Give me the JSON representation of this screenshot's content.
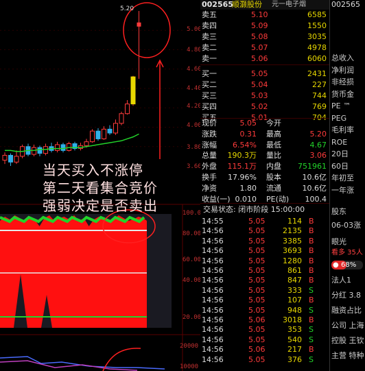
{
  "stock": {
    "code": "002565",
    "name": "顺灏股份",
    "sector": "元一电子烟"
  },
  "side_code": "002565",
  "chart": {
    "price_labels": [
      "5.20",
      "5.00",
      "4.80",
      "4.60",
      "4.40",
      "4.20",
      "4.00",
      "3.80",
      "3.60"
    ],
    "high_label": "5.20",
    "indicator_labels": [
      "100.0",
      "80.00",
      "60.00",
      "40.00",
      "20.00"
    ],
    "volume_labels": [
      "20000",
      "10000"
    ],
    "annotation": [
      "当天买入不涨停",
      "第二天看集合竞价",
      "强弱决定是否卖出"
    ],
    "candles": [
      {
        "o": 3.66,
        "c": 3.71,
        "h": 3.74,
        "l": 3.62
      },
      {
        "o": 3.71,
        "c": 3.64,
        "h": 3.73,
        "l": 3.6
      },
      {
        "o": 3.64,
        "c": 3.7,
        "h": 3.76,
        "l": 3.62
      },
      {
        "o": 3.7,
        "c": 3.8,
        "h": 3.82,
        "l": 3.68
      },
      {
        "o": 3.8,
        "c": 3.72,
        "h": 3.83,
        "l": 3.7
      },
      {
        "o": 3.72,
        "c": 3.79,
        "h": 3.82,
        "l": 3.7
      },
      {
        "o": 3.79,
        "c": 3.73,
        "h": 3.81,
        "l": 3.7
      },
      {
        "o": 3.73,
        "c": 3.8,
        "h": 3.83,
        "l": 3.71
      },
      {
        "o": 3.8,
        "c": 3.76,
        "h": 3.84,
        "l": 3.74
      },
      {
        "o": 3.76,
        "c": 3.82,
        "h": 3.85,
        "l": 3.74
      },
      {
        "o": 3.82,
        "c": 3.76,
        "h": 3.84,
        "l": 3.74
      },
      {
        "o": 3.76,
        "c": 3.83,
        "h": 3.85,
        "l": 3.75
      },
      {
        "o": 3.83,
        "c": 3.78,
        "h": 3.85,
        "l": 3.76
      },
      {
        "o": 3.78,
        "c": 3.81,
        "h": 3.84,
        "l": 3.76
      },
      {
        "o": 3.81,
        "c": 3.85,
        "h": 3.88,
        "l": 3.79
      },
      {
        "o": 3.85,
        "c": 3.96,
        "h": 3.98,
        "l": 3.84
      },
      {
        "o": 3.96,
        "c": 3.88,
        "h": 3.99,
        "l": 3.86
      },
      {
        "o": 3.88,
        "c": 3.98,
        "h": 4.01,
        "l": 3.87
      },
      {
        "o": 3.98,
        "c": 3.94,
        "h": 4.02,
        "l": 3.92
      },
      {
        "o": 3.94,
        "c": 4.04,
        "h": 4.08,
        "l": 3.92
      },
      {
        "o": 4.04,
        "c": 4.14,
        "h": 4.16,
        "l": 4.02
      },
      {
        "o": 4.14,
        "c": 4.24,
        "h": 4.28,
        "l": 4.13
      },
      {
        "o": 4.24,
        "c": 4.52,
        "h": 4.53,
        "l": 4.22
      },
      {
        "o": 4.52,
        "c": 5.05,
        "h": 5.2,
        "l": 4.5
      }
    ],
    "ma": [
      3.76,
      3.76,
      3.75,
      3.75,
      3.76,
      3.76,
      3.77,
      3.77,
      3.78,
      3.78,
      3.78,
      3.79,
      3.79,
      3.79,
      3.8,
      3.81,
      3.82,
      3.83,
      3.84,
      3.85,
      3.86,
      3.88,
      3.9,
      3.93
    ]
  },
  "order_book": [
    {
      "label": "卖五",
      "price": "5.10",
      "vol": "6585"
    },
    {
      "label": "卖四",
      "price": "5.09",
      "vol": "1550"
    },
    {
      "label": "卖三",
      "price": "5.08",
      "vol": "3035"
    },
    {
      "label": "卖二",
      "price": "5.07",
      "vol": "4978"
    },
    {
      "label": "卖一",
      "price": "5.06",
      "vol": "6060"
    },
    {
      "label": "买一",
      "price": "5.05",
      "vol": "2431"
    },
    {
      "label": "买二",
      "price": "5.04",
      "vol": "227"
    },
    {
      "label": "买三",
      "price": "5.03",
      "vol": "744"
    },
    {
      "label": "买四",
      "price": "5.02",
      "vol": "769"
    },
    {
      "label": "买五",
      "price": "5.01",
      "vol": "704"
    }
  ],
  "stats": [
    {
      "l1": "现价",
      "v1": "5.05",
      "l2": "今开",
      "v2": "",
      "c1": "red",
      "c2": "red"
    },
    {
      "l1": "涨跌",
      "v1": "0.31",
      "l2": "最高",
      "v2": "5.20",
      "c1": "red",
      "c2": "red"
    },
    {
      "l1": "涨幅",
      "v1": "6.54%",
      "l2": "最低",
      "v2": "4.67",
      "c1": "red",
      "c2": "green"
    },
    {
      "l1": "总量",
      "v1": "190.3万",
      "l2": "量比",
      "v2": "3.06",
      "c1": "yellow",
      "c2": "red"
    },
    {
      "l1": "外盘",
      "v1": "115.1万",
      "l2": "内盘",
      "v2": "751961",
      "c1": "red",
      "c2": "green"
    },
    {
      "l1": "换手",
      "v1": "17.96%",
      "l2": "股本",
      "v2": "10.6亿",
      "c1": "white",
      "c2": "white"
    },
    {
      "l1": "净资",
      "v1": "1.80",
      "l2": "流通",
      "v2": "10.6亿",
      "c1": "white",
      "c2": "white"
    },
    {
      "l1": "收益(一)",
      "v1": "0.010",
      "l2": "PE(动)",
      "v2": "100.4",
      "c1": "white",
      "c2": "white"
    }
  ],
  "trade_status": "交易状态: 闭市阶段 15:00:00",
  "ticks": [
    {
      "time": "14:55",
      "price": "5.05",
      "vol": "114",
      "bs": "B"
    },
    {
      "time": "14:56",
      "price": "5.05",
      "vol": "2135",
      "bs": "B"
    },
    {
      "time": "14:56",
      "price": "5.05",
      "vol": "3385",
      "bs": "B"
    },
    {
      "time": "14:56",
      "price": "5.05",
      "vol": "3693",
      "bs": "B"
    },
    {
      "time": "14:56",
      "price": "5.05",
      "vol": "1280",
      "bs": "B"
    },
    {
      "time": "14:56",
      "price": "5.05",
      "vol": "861",
      "bs": "B"
    },
    {
      "time": "14:56",
      "price": "5.05",
      "vol": "847",
      "bs": "B"
    },
    {
      "time": "14:56",
      "price": "5.05",
      "vol": "333",
      "bs": "S"
    },
    {
      "time": "14:56",
      "price": "5.05",
      "vol": "107",
      "bs": "B"
    },
    {
      "time": "14:56",
      "price": "5.05",
      "vol": "948",
      "bs": "S"
    },
    {
      "time": "14:56",
      "price": "5.06",
      "vol": "3018",
      "bs": "B"
    },
    {
      "time": "14:56",
      "price": "5.05",
      "vol": "353",
      "bs": "S"
    },
    {
      "time": "14:56",
      "price": "5.05",
      "vol": "540",
      "bs": "S"
    },
    {
      "time": "14:56",
      "price": "5.06",
      "vol": "217",
      "bs": "B"
    },
    {
      "time": "14:56",
      "price": "5.05",
      "vol": "376",
      "bs": "S"
    }
  ],
  "side": {
    "items": [
      "总收入",
      "净利润",
      "非经损",
      "货币金",
      "PE ™",
      "PEG",
      "毛利率",
      "ROE",
      "20日",
      "60日",
      "年初至",
      "一年涨"
    ],
    "items2": [
      "股东",
      "06-03涨",
      "眼光",
      "看多 35人"
    ],
    "pct": "68%",
    "items3": [
      "法人1",
      "分红 3.8",
      "融资占比",
      "公司 上海",
      "控股 王钦",
      "主营 特种"
    ]
  },
  "colors": {
    "up": "#ff3b3b",
    "down": "#22d32a",
    "accent": "#e8d800"
  }
}
